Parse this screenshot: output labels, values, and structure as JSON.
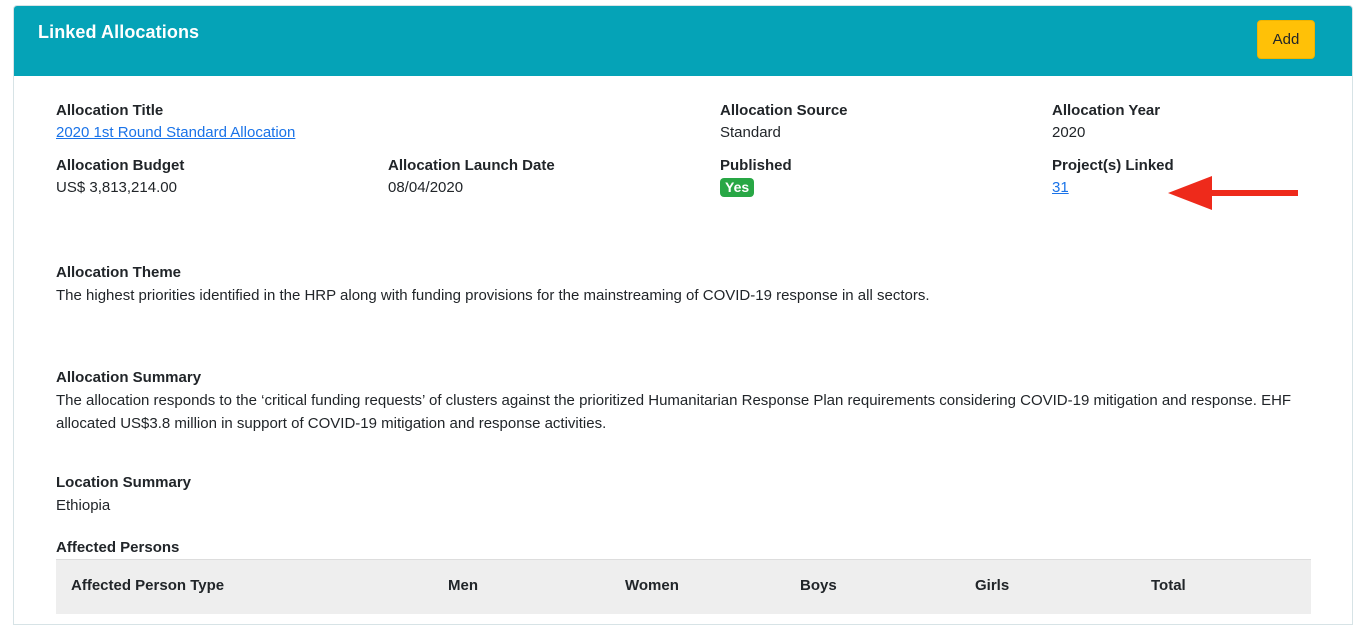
{
  "panel": {
    "title": "Linked Allocations",
    "add_label": "Add",
    "header_color": "#05a3b7",
    "add_color": "#ffc107"
  },
  "fields": {
    "allocation_title_label": "Allocation Title",
    "allocation_title_value": "2020 1st Round Standard Allocation",
    "allocation_source_label": "Allocation Source",
    "allocation_source_value": "Standard",
    "allocation_year_label": "Allocation Year",
    "allocation_year_value": "2020",
    "allocation_budget_label": "Allocation Budget",
    "allocation_budget_value": "US$ 3,813,214.00",
    "launch_date_label": "Allocation Launch Date",
    "launch_date_value": "08/04/2020",
    "published_label": "Published",
    "published_value": "Yes",
    "projects_linked_label": "Project(s) Linked",
    "projects_linked_value": "31"
  },
  "sections": {
    "theme_label": "Allocation Theme",
    "theme_text": "The highest priorities identified in the HRP along with funding provisions for the mainstreaming of COVID-19 response in all sectors.",
    "summary_label": "Allocation Summary",
    "summary_text": "The allocation responds to the ‘critical funding requests’ of clusters against the prioritized Humanitarian Response Plan requirements considering COVID-19 mitigation and response. EHF allocated US$3.8 million in support of COVID-19 mitigation and response activities.",
    "location_label": "Location Summary",
    "location_text": "Ethiopia",
    "affected_label": "Affected Persons"
  },
  "table": {
    "columns": [
      "Affected Person Type",
      "Men",
      "Women",
      "Boys",
      "Girls",
      "Total"
    ]
  },
  "annotation": {
    "arrow_color": "#ee2a1b",
    "arrow_icon": "red-arrow-pointing-left"
  }
}
